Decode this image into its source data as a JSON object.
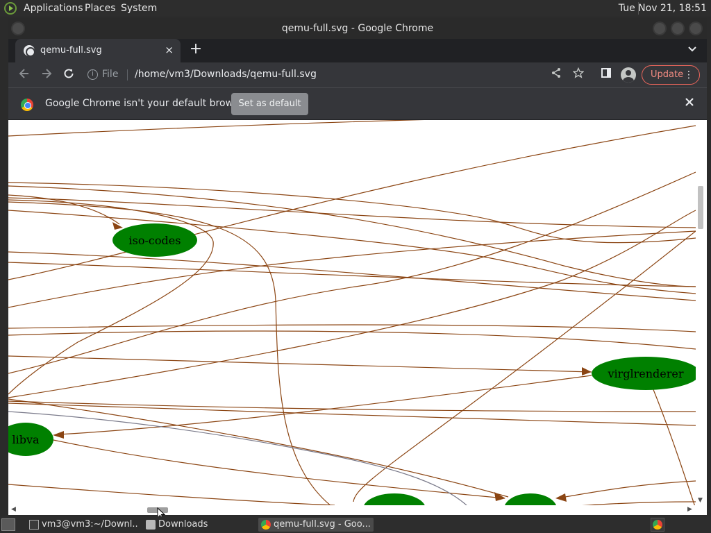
{
  "topbar": {
    "menus": [
      "Applications",
      "Places",
      "System"
    ],
    "clock": "Tue Nov 21, 18:51"
  },
  "window": {
    "title": "qemu-full.svg - Google Chrome"
  },
  "tab": {
    "title": "qemu-full.svg",
    "close": "×",
    "new_tab": "+"
  },
  "toolbar": {
    "scheme": "File",
    "url": "/home/vm3/Downloads/qemu-full.svg",
    "update_label": "Update"
  },
  "infobar": {
    "message": "Google Chrome isn't your default browser",
    "button": "Set as default"
  },
  "graph": {
    "edge_color": "#8b4513",
    "node_color": "#008000",
    "nodes": [
      "iso-codes",
      "virglrenderer",
      "libva"
    ]
  },
  "taskbar": {
    "items": [
      "vm3@vm3:~/Downl...",
      "Downloads",
      "qemu-full.svg - Goo..."
    ]
  }
}
